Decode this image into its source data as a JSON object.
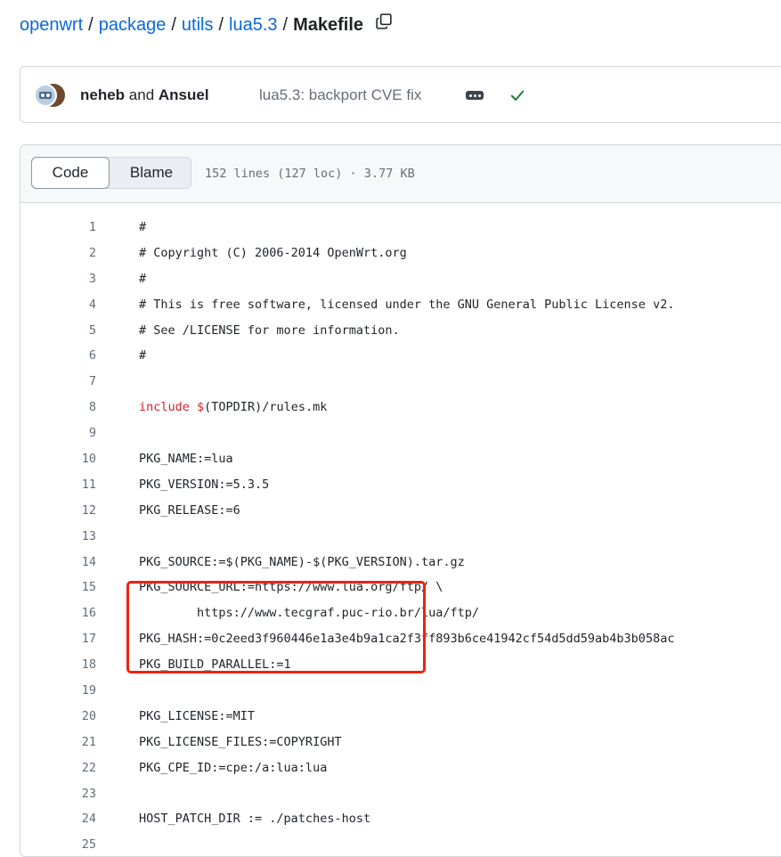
{
  "breadcrumb": {
    "parts": [
      "openwrt",
      "package",
      "utils",
      "lua5.3"
    ],
    "file": "Makefile"
  },
  "commit": {
    "authors_a": "neheb",
    "authors_and": " and ",
    "authors_b": "Ansuel",
    "message": "lua5.3: backport CVE fix",
    "status": "success"
  },
  "file_header": {
    "code_tab": "Code",
    "blame_tab": "Blame",
    "info": "152 lines (127 loc) · 3.77 KB"
  },
  "code_lines": [
    {
      "n": "1",
      "text": "#"
    },
    {
      "n": "2",
      "text": "# Copyright (C) 2006-2014 OpenWrt.org"
    },
    {
      "n": "3",
      "text": "#"
    },
    {
      "n": "4",
      "text": "# This is free software, licensed under the GNU General Public License v2."
    },
    {
      "n": "5",
      "text": "# See /LICENSE for more information."
    },
    {
      "n": "6",
      "text": "#"
    },
    {
      "n": "7",
      "text": ""
    },
    {
      "n": "8",
      "kw": "include",
      "var": " $",
      "rest": "(TOPDIR)/rules.mk"
    },
    {
      "n": "9",
      "text": ""
    },
    {
      "n": "10",
      "text": "PKG_NAME:=lua"
    },
    {
      "n": "11",
      "text": "PKG_VERSION:=5.3.5"
    },
    {
      "n": "12",
      "text": "PKG_RELEASE:=6"
    },
    {
      "n": "13",
      "text": ""
    },
    {
      "n": "14",
      "text": "PKG_SOURCE:=$(PKG_NAME)-$(PKG_VERSION).tar.gz"
    },
    {
      "n": "15",
      "text": "PKG_SOURCE_URL:=https://www.lua.org/ftp/ \\"
    },
    {
      "n": "16",
      "text": "        https://www.tecgraf.puc-rio.br/lua/ftp/"
    },
    {
      "n": "17",
      "text": "PKG_HASH:=0c2eed3f960446e1a3e4b9a1ca2f3ff893b6ce41942cf54d5dd59ab4b3b058ac"
    },
    {
      "n": "18",
      "text": "PKG_BUILD_PARALLEL:=1"
    },
    {
      "n": "19",
      "text": ""
    },
    {
      "n": "20",
      "text": "PKG_LICENSE:=MIT"
    },
    {
      "n": "21",
      "text": "PKG_LICENSE_FILES:=COPYRIGHT"
    },
    {
      "n": "22",
      "text": "PKG_CPE_ID:=cpe:/a:lua:lua"
    },
    {
      "n": "23",
      "text": ""
    },
    {
      "n": "24",
      "text": "HOST_PATCH_DIR := ./patches-host"
    },
    {
      "n": "25",
      "text": ""
    }
  ],
  "colors": {
    "link": "#0969da",
    "highlight_box": "#ee2211",
    "success": "#1a7f37"
  }
}
